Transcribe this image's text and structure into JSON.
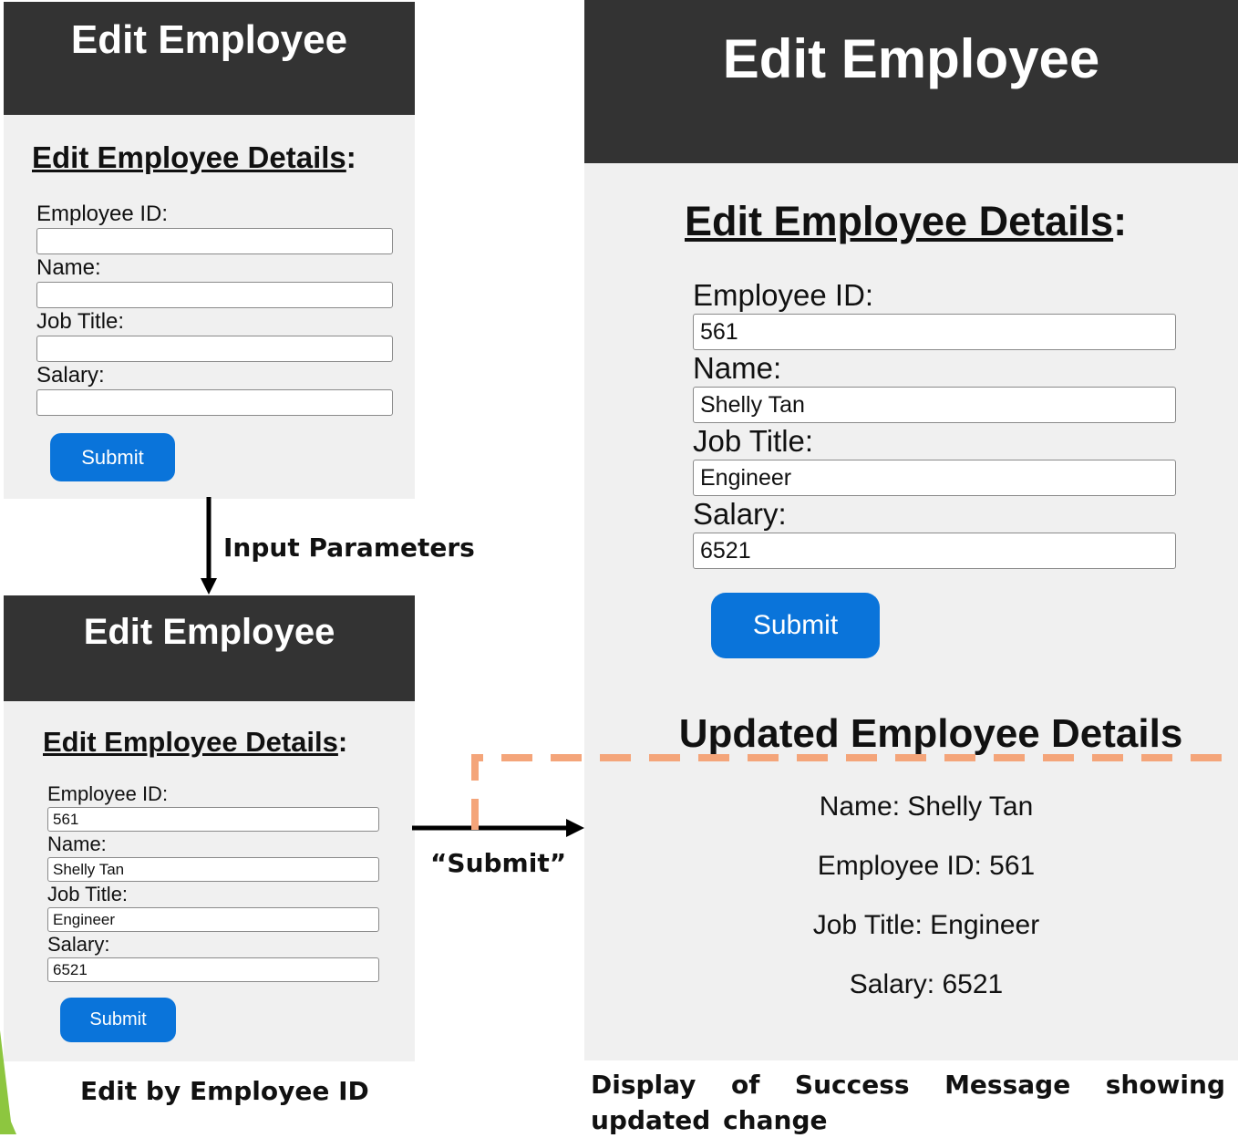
{
  "form_panels": {
    "header_title": "Edit Employee",
    "subtitle": "Edit Employee Details",
    "subtitle_suffix": ":",
    "labels": {
      "employee_id": "Employee ID:",
      "name": "Name:",
      "job_title": "Job Title:",
      "salary": "Salary:"
    },
    "submit_label": "Submit"
  },
  "filled_values": {
    "employee_id": "561",
    "name": "Shelly Tan",
    "job_title": "Engineer",
    "salary": "6521"
  },
  "annotations": {
    "input_parameters": "Input Parameters",
    "submit_action": "“Submit”",
    "caption_left": "Edit by Employee ID",
    "caption_right": "Display of Success Message showing updated change"
  },
  "result": {
    "title": "Updated Employee Details",
    "lines": [
      "Name: Shelly Tan",
      "Employee ID: 561",
      "Job Title: Engineer",
      "Salary: 6521"
    ]
  },
  "colors": {
    "header_bg": "#333333",
    "panel_bg": "#f0f0f0",
    "button_blue": "#0a74da",
    "dash_orange": "#f4a57a",
    "accent_green": "#8dc63f"
  }
}
